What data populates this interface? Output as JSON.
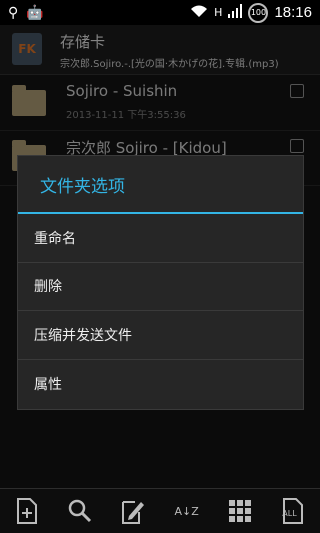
{
  "status": {
    "time": "18:16",
    "battery": "100",
    "signal": "H",
    "icons_left": [
      "usb-icon",
      "android-icon"
    ],
    "icons_right": [
      "wifi-icon",
      "signal-icon",
      "battery-icon"
    ]
  },
  "header": {
    "title": "存储卡",
    "subtitle": "宗次郎.Sojiro.-.[光の国·木かげの花].专辑.(mp3)",
    "app_icon_text": "FK"
  },
  "files": [
    {
      "name": "Sojiro - Suishin",
      "date": "2013-11-11 下午3:55:36"
    },
    {
      "name": "宗次郎 Sojiro - [Kidou]",
      "date": ""
    }
  ],
  "dialog": {
    "title": "文件夹选项",
    "items": [
      "重命名",
      "删除",
      "压缩并发送文件",
      "属性"
    ]
  },
  "toolbar": {
    "icons": [
      "new-file-icon",
      "search-icon",
      "edit-icon",
      "sort-az-icon",
      "grid-view-icon",
      "select-all-icon"
    ],
    "sort_glyph": "A↓Z",
    "select_all_label": "ALL"
  }
}
